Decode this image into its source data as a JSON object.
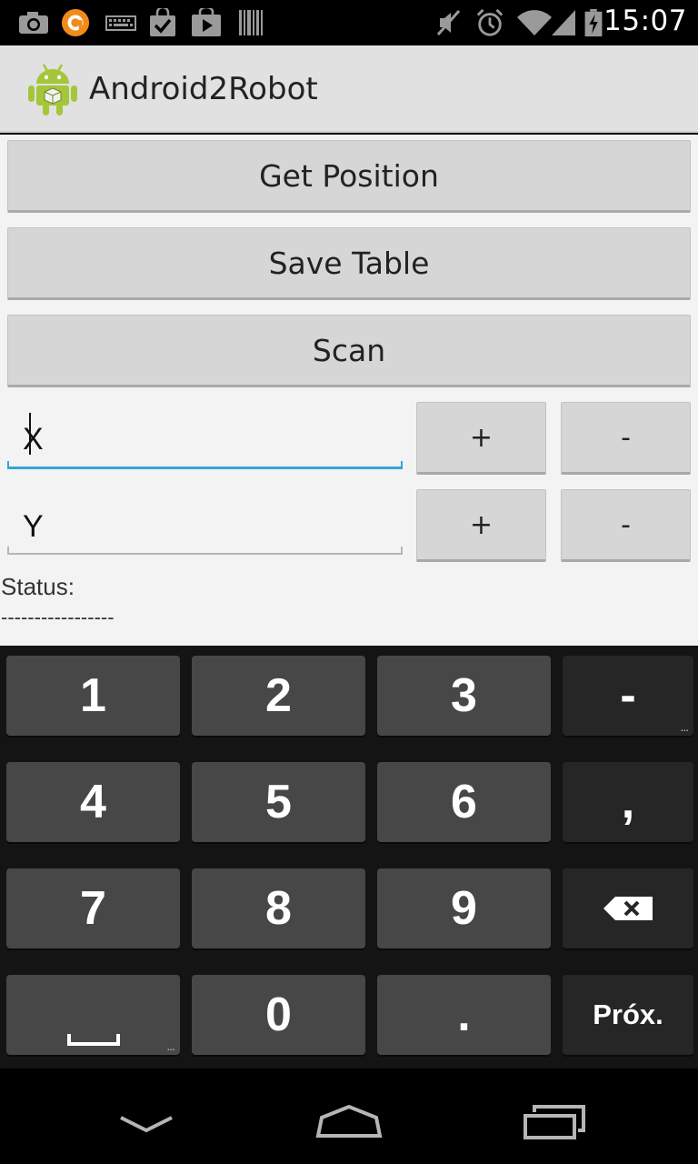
{
  "status_bar": {
    "time": "15:07",
    "icons": [
      "camera-icon",
      "avast-icon",
      "keyboard-icon",
      "bag-check-icon",
      "play-store-icon",
      "barcode-icon",
      "mute-icon",
      "alarm-icon",
      "wifi-icon",
      "signal-icon",
      "battery-charging-icon"
    ]
  },
  "action_bar": {
    "title": "Android2Robot",
    "icon": "android-robot-icon",
    "brand_color": "#a4c639"
  },
  "buttons": {
    "get_position": "Get Position",
    "save_table": "Save Table",
    "scan": "Scan"
  },
  "fields": {
    "x": {
      "value": "X",
      "plus": "+",
      "minus": "-"
    },
    "y": {
      "value": "Y",
      "plus": "+",
      "minus": "-"
    },
    "focus_color": "#33a6d6"
  },
  "status": {
    "label": "Status:",
    "value": "-----------------"
  },
  "keyboard": {
    "row1": [
      "1",
      "2",
      "3",
      "-"
    ],
    "row2": [
      "4",
      "5",
      "6",
      ","
    ],
    "row3": [
      "7",
      "8",
      "9"
    ],
    "row4": [
      "0",
      ".",
      "Próx."
    ],
    "more_hint": "...",
    "backspace_icon": "backspace-icon",
    "space_icon": "space-bar-icon"
  },
  "nav_bar": {
    "icons": [
      "back-icon",
      "home-icon",
      "recent-apps-icon"
    ]
  }
}
